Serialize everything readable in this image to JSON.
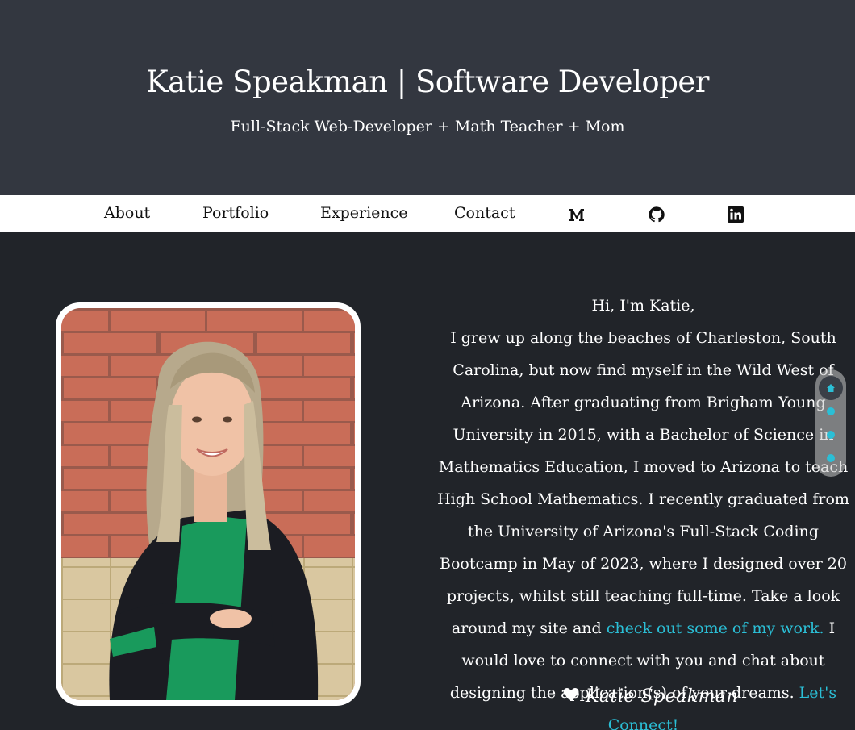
{
  "hero": {
    "title": "Katie Speakman | Software Developer",
    "subtitle": "Full-Stack Web-Developer + Math Teacher + Mom"
  },
  "nav": {
    "links": [
      "About",
      "Portfolio",
      "Experience",
      "Contact"
    ],
    "icons": [
      "medium-icon",
      "github-icon",
      "linkedin-icon"
    ]
  },
  "bio": {
    "greeting": "Hi, I'm Katie,",
    "body_1": "I grew up along the beaches of Charleston, South Carolina, but now find myself in the Wild West of Arizona. After graduating from Brigham Young University in 2015, with a Bachelor of Science in Mathematics Education, I moved to Arizona to teach High School Mathematics. I recently graduated from the University of Arizona's Full-Stack Coding Bootcamp in May of 2023, where I designed over 20 projects, whilst still teaching full-time. Take a look around my site and",
    "work_link": "check out some of my work.",
    "body_2": "I would love to connect with you and chat about designing the application(s) of your dreams.",
    "connect_link": "Let's Connect!"
  },
  "signature": {
    "name": "Katie Speakman",
    "icon": "heart-icon"
  },
  "side_nav": {
    "icons": [
      "home-icon",
      "dot",
      "dot",
      "dot"
    ]
  },
  "colors": {
    "hero_bg": "#333740",
    "page_bg": "#212429",
    "accent": "#2bbfd6",
    "nav_bg": "#ffffff"
  }
}
